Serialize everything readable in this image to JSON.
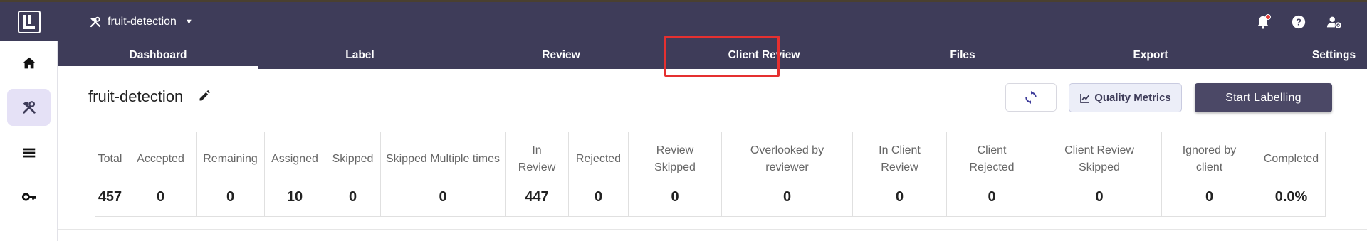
{
  "header": {
    "project_name": "fruit-detection"
  },
  "tabs": [
    {
      "label": "Dashboard",
      "active": true
    },
    {
      "label": "Label",
      "active": false
    },
    {
      "label": "Review",
      "active": false
    },
    {
      "label": "Client Review",
      "active": false
    },
    {
      "label": "Files",
      "active": false
    },
    {
      "label": "Export",
      "active": false
    },
    {
      "label": "Settings",
      "active": false
    }
  ],
  "sidebar": {
    "items": [
      {
        "icon": "home-icon"
      },
      {
        "icon": "tools-icon",
        "active": true
      },
      {
        "icon": "list-icon"
      },
      {
        "icon": "key-icon"
      }
    ]
  },
  "top_icons": [
    "notification-bell-icon",
    "help-icon",
    "user-settings-icon"
  ],
  "main": {
    "title": "fruit-detection",
    "quality_metrics_label": "Quality Metrics",
    "start_labelling_label": "Start Labelling"
  },
  "stats": [
    {
      "label": "Total",
      "value": "457"
    },
    {
      "label": "Accepted",
      "value": "0"
    },
    {
      "label": "Remaining",
      "value": "0"
    },
    {
      "label": "Assigned",
      "value": "10"
    },
    {
      "label": "Skipped",
      "value": "0"
    },
    {
      "label": "Skipped Multiple times",
      "value": "0"
    },
    {
      "label": "In Review",
      "value": "447"
    },
    {
      "label": "Rejected",
      "value": "0"
    },
    {
      "label": "Review Skipped",
      "value": "0"
    },
    {
      "label": "Overlooked by reviewer",
      "value": "0"
    },
    {
      "label": "In Client Review",
      "value": "0"
    },
    {
      "label": "Client Rejected",
      "value": "0"
    },
    {
      "label": "Client Review Skipped",
      "value": "0"
    },
    {
      "label": "Ignored by client",
      "value": "0"
    },
    {
      "label": "Completed",
      "value": "0.0%"
    }
  ],
  "colors": {
    "nav_bg": "#3e3c59",
    "accent": "#4b4866",
    "sidebar_active_bg": "#e5e1f6",
    "highlight_box": "#e53030",
    "notification_dot": "#e53935"
  }
}
